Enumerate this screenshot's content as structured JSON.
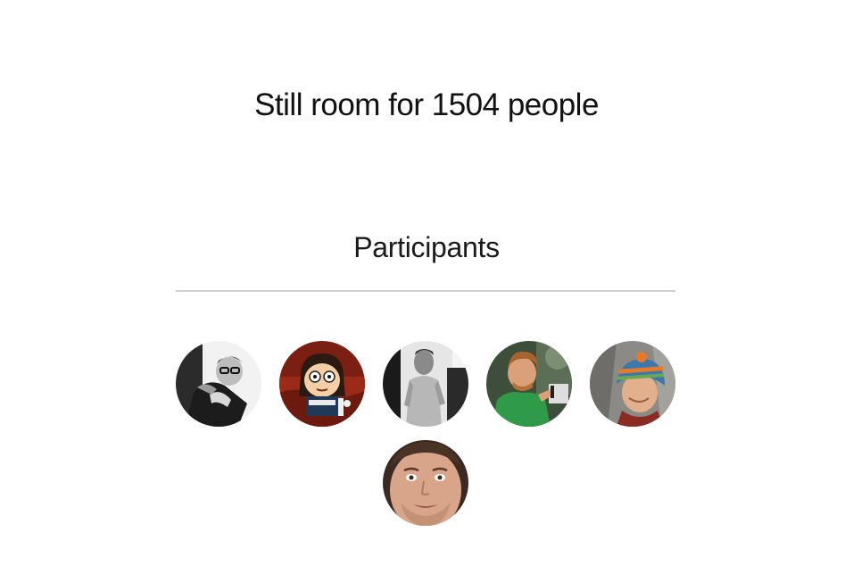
{
  "status": {
    "room_text": "Still room for 1504 people"
  },
  "participants": {
    "heading": "Participants",
    "avatars": [
      {
        "name": "participant-avatar-1"
      },
      {
        "name": "participant-avatar-2"
      },
      {
        "name": "participant-avatar-3"
      },
      {
        "name": "participant-avatar-4"
      },
      {
        "name": "participant-avatar-5"
      },
      {
        "name": "participant-avatar-6"
      }
    ]
  }
}
